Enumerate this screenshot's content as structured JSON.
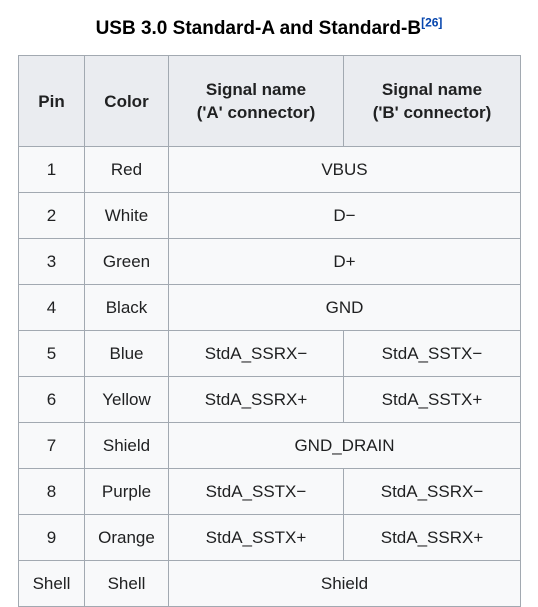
{
  "caption": {
    "title": "USB 3.0 Standard-A and Standard-B",
    "reference": "[26]",
    "reference_color": "#0645ad"
  },
  "table": {
    "headers": {
      "pin": "Pin",
      "color": "Color",
      "signal_a_line1": "Signal name",
      "signal_a_line2": "('A' connector)",
      "signal_b_line1": "Signal name",
      "signal_b_line2": "('B' connector)"
    },
    "rows": [
      {
        "pin": "1",
        "color": "Red",
        "signal_a": "VBUS",
        "signal_b": "",
        "merged": true
      },
      {
        "pin": "2",
        "color": "White",
        "signal_a": "D−",
        "signal_b": "",
        "merged": true
      },
      {
        "pin": "3",
        "color": "Green",
        "signal_a": "D+",
        "signal_b": "",
        "merged": true
      },
      {
        "pin": "4",
        "color": "Black",
        "signal_a": "GND",
        "signal_b": "",
        "merged": true
      },
      {
        "pin": "5",
        "color": "Blue",
        "signal_a": "StdA_SSRX−",
        "signal_b": "StdA_SSTX−",
        "merged": false
      },
      {
        "pin": "6",
        "color": "Yellow",
        "signal_a": "StdA_SSRX+",
        "signal_b": "StdA_SSTX+",
        "merged": false
      },
      {
        "pin": "7",
        "color": "Shield",
        "signal_a": "GND_DRAIN",
        "signal_b": "",
        "merged": true
      },
      {
        "pin": "8",
        "color": "Purple",
        "signal_a": "StdA_SSTX−",
        "signal_b": "StdA_SSRX−",
        "merged": false
      },
      {
        "pin": "9",
        "color": "Orange",
        "signal_a": "StdA_SSTX+",
        "signal_b": "StdA_SSRX+",
        "merged": false
      },
      {
        "pin": "Shell",
        "color": "Shell",
        "signal_a": "Shield",
        "signal_b": "",
        "merged": true
      }
    ]
  },
  "style": {
    "border_color": "#a2a9b1",
    "header_background": "#eaecf0",
    "cell_background": "#f8f9fa",
    "text_color": "#202122",
    "page_background": "#ffffff"
  }
}
